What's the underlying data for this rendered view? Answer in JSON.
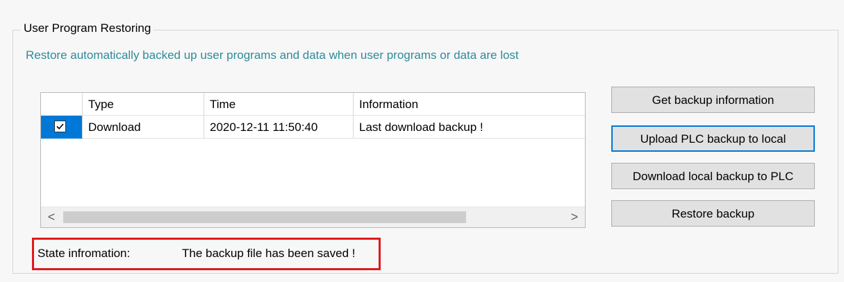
{
  "group": {
    "title": "User Program Restoring",
    "description": "Restore automatically backed up user programs and data when user programs or data are lost"
  },
  "table": {
    "columns": [
      "",
      "Type",
      "Time",
      "Information"
    ],
    "rows": [
      {
        "checked": true,
        "type": "Download",
        "time": "2020-12-11 11:50:40",
        "information": "Last download backup !"
      }
    ]
  },
  "scrollbar": {
    "left_arrow": "<",
    "right_arrow": ">"
  },
  "buttons": {
    "get_backup_info": "Get backup information",
    "upload_plc_backup": "Upload PLC backup to local",
    "download_local_backup": "Download local backup to PLC",
    "restore_backup": "Restore backup"
  },
  "state": {
    "label": "State infromation:",
    "value": "The backup file has been saved !"
  },
  "colors": {
    "selection": "#0078d7",
    "description_text": "#2e8b9a",
    "highlight_box": "#e0191e"
  }
}
